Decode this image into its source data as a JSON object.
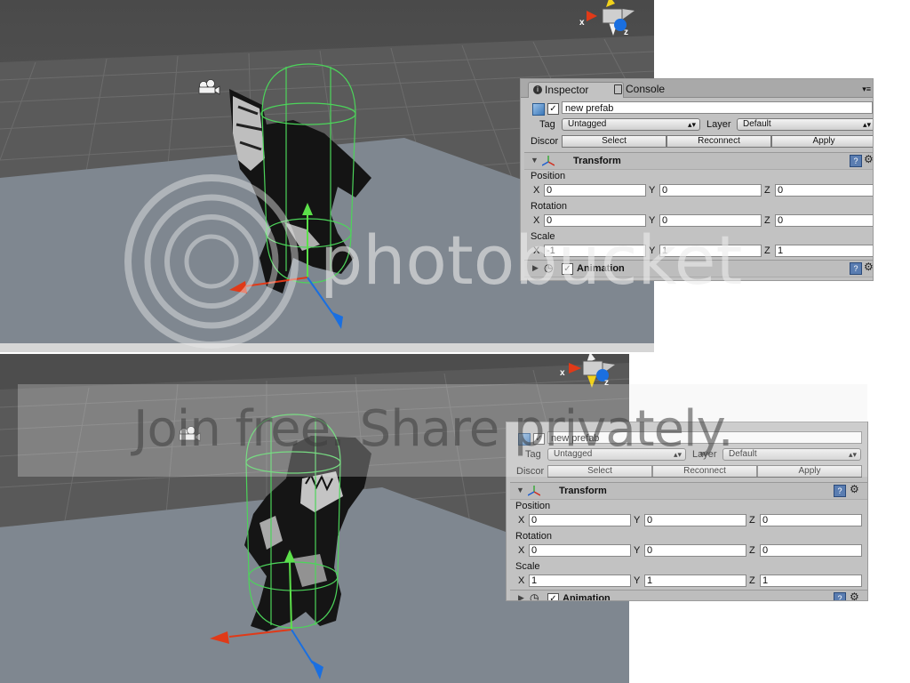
{
  "colors": {
    "scene_sky": "#505050",
    "scene_ground": "#7f8790",
    "grid_line": "#6a6a6a",
    "capsule_green": "#4cd45a",
    "axis_x_red": "#e03a18",
    "axis_y_green": "#5ce04a",
    "axis_z_blue": "#1a6fe0",
    "inspector_bg": "#c2c2c2",
    "brand_watermark": "#e8e8e8"
  },
  "top": {
    "gizmo": {
      "x_label": "x",
      "z_label": "z",
      "icon": "scene-orientation-gizmo-icon"
    },
    "inspector": {
      "tabs": [
        {
          "label": "Inspector",
          "icon": "info-icon"
        },
        {
          "label": "Console",
          "icon": "console-icon"
        }
      ],
      "object_name": "new prefab",
      "tag_label": "Tag",
      "tag_value": "Untagged",
      "layer_label": "Layer",
      "layer_value": "Default",
      "prefab_label": "Discor",
      "buttons": {
        "select": "Select",
        "reconnect": "Reconnect",
        "apply": "Apply"
      },
      "transform_title": "Transform",
      "position_label": "Position",
      "rotation_label": "Rotation",
      "scale_label": "Scale",
      "axis_labels": {
        "x": "X",
        "y": "Y",
        "z": "Z"
      },
      "position": {
        "x": "0",
        "y": "0",
        "z": "0"
      },
      "rotation": {
        "x": "0",
        "y": "0",
        "z": "0"
      },
      "scale": {
        "x": "-1",
        "y": "1",
        "z": "1"
      },
      "animation_title": "Animation"
    }
  },
  "bottom": {
    "gizmo": {
      "x_label": "x",
      "z_label": "z",
      "icon": "scene-orientation-gizmo-icon"
    },
    "inspector": {
      "object_name": "new prefab",
      "tag_label": "Tag",
      "tag_value": "Untagged",
      "layer_label": "Layer",
      "layer_value": "Default",
      "prefab_label": "Discor",
      "buttons": {
        "select": "Select",
        "reconnect": "Reconnect",
        "apply": "Apply"
      },
      "transform_title": "Transform",
      "position_label": "Position",
      "rotation_label": "Rotation",
      "scale_label": "Scale",
      "axis_labels": {
        "x": "X",
        "y": "Y",
        "z": "Z"
      },
      "position": {
        "x": "0",
        "y": "0",
        "z": "0"
      },
      "rotation": {
        "x": "0",
        "y": "0",
        "z": "0"
      },
      "scale": {
        "x": "1",
        "y": "1",
        "z": "1"
      },
      "animation_title": "Animation"
    }
  },
  "watermark": {
    "brand": "photobucket",
    "slogan": "Join free. Share privately."
  }
}
